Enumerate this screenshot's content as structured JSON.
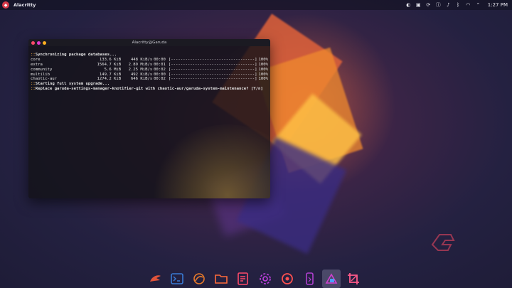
{
  "topbar": {
    "app_title": "Alacritty",
    "clock": "1:27 PM"
  },
  "terminal": {
    "title": "Alacritty@Garuda",
    "sync_line": "Synchronizing package databases...",
    "repos": [
      {
        "name": "core",
        "size": "133.6 KiB",
        "rate": "448 KiB/s",
        "time": "00:00",
        "bar": "[-----------------------------------]",
        "pct": "100%"
      },
      {
        "name": "extra",
        "size": "1564.7 KiB",
        "rate": "2.89 MiB/s",
        "time": "00:01",
        "bar": "[-----------------------------------]",
        "pct": "100%"
      },
      {
        "name": "community",
        "size": "5.6 MiB",
        "rate": "2.25 MiB/s",
        "time": "00:02",
        "bar": "[-----------------------------------]",
        "pct": "100%"
      },
      {
        "name": "multilib",
        "size": "149.7 KiB",
        "rate": "492 KiB/s",
        "time": "00:00",
        "bar": "[-----------------------------------]",
        "pct": "100%"
      },
      {
        "name": "chaotic-aur",
        "size": "1274.2 KiB",
        "rate": "646 KiB/s",
        "time": "00:02",
        "bar": "[-----------------------------------]",
        "pct": "100%"
      }
    ],
    "upgrade_line": "Starting full system upgrade...",
    "replace_line": "Replace garuda-settings-manager-knotifier-git with chaotic-aur/garuda-system-maintenance? [Y/n]",
    "prompt_prefix": "::"
  },
  "dock": {
    "items": [
      {
        "name": "garuda-launcher-icon",
        "color": "#e0533a"
      },
      {
        "name": "terminal-icon",
        "color": "#3a7bd5"
      },
      {
        "name": "browser-icon",
        "color": "#e87a2a"
      },
      {
        "name": "file-manager-icon",
        "color": "#ff6a3a"
      },
      {
        "name": "text-editor-icon",
        "color": "#ff4a6a"
      },
      {
        "name": "settings-icon",
        "color": "#c040e0"
      },
      {
        "name": "assistant-icon",
        "color": "#ff5050"
      },
      {
        "name": "phone-icon",
        "color": "#b040d0"
      },
      {
        "name": "welcome-icon",
        "color": "#d040d0"
      },
      {
        "name": "screenshot-icon",
        "color": "#ff5a8a"
      }
    ],
    "active_index": 8
  },
  "colors": {
    "accent": "#d89a3c",
    "dot_close": "#ff4a6a",
    "dot_min": "#e03ad0",
    "dot_max": "#ffb020"
  }
}
